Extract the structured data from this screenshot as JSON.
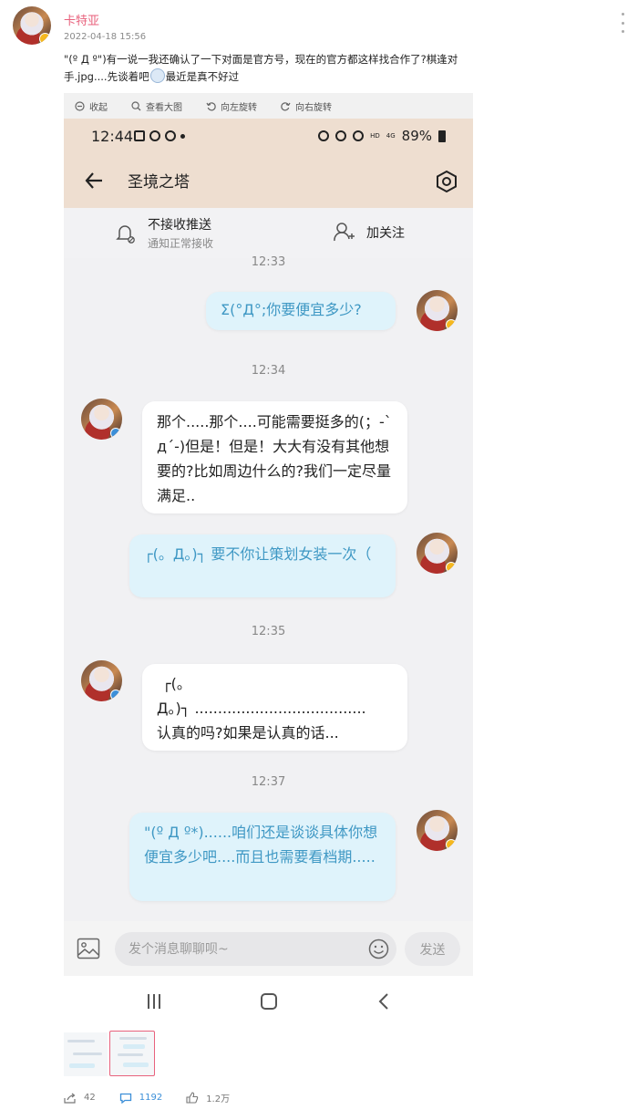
{
  "post": {
    "username": "卡特亚",
    "timestamp": "2022-04-18 15:56",
    "text_before_emoji": "\"(º Д º\")有一说一我还确认了一下对面是官方号，现在的官方都这样找合作了?棋逢对手.jpg....先谈着吧",
    "text_after_emoji": "最近是真不好过"
  },
  "viewer_toolbar": {
    "collapse": "收起",
    "view_large": "查看大图",
    "rotate_left": "向左旋转",
    "rotate_right": "向右旋转"
  },
  "phone": {
    "status_time": "12:44",
    "status_hd": "HD",
    "status_4g": "4G",
    "battery": "89%",
    "chat_title": "圣境之塔",
    "push_label": "不接收推送",
    "push_sub": "通知正常接收",
    "follow_label": "加关注",
    "messages": {
      "t1": "12:33",
      "m1": "Σ(°Д°;你要便宜多少?",
      "t2": "12:34",
      "m2": "那个.....那个....可能需要挺多的(；-` д´-)但是！但是！大大有没有其他想要的?比如周边什么的?我们一定尽量满足..",
      "m3": "┌(。Д。)┐ 要不你让策划女装一次（",
      "t3": "12:35",
      "m4a": "┌(。",
      "m4b": "Д。)┐ .....................................",
      "m4c": "认真的吗?如果是认真的话...",
      "t4": "12:37",
      "m5": "\"(º Д º*)......咱们还是谈谈具体你想便宜多少吧....而且也需要看档期....."
    },
    "input_placeholder": "发个消息聊聊呗~",
    "send": "发送"
  },
  "stats": {
    "share": "42",
    "comments": "1192",
    "likes": "1.2万"
  },
  "colors": {
    "username": "#e8627d",
    "status_bar_bg": "#eeded0",
    "outgoing_bubble_bg": "#dff3fb",
    "outgoing_bubble_text": "#3f98c4",
    "active_stat": "#3c8fd8"
  }
}
